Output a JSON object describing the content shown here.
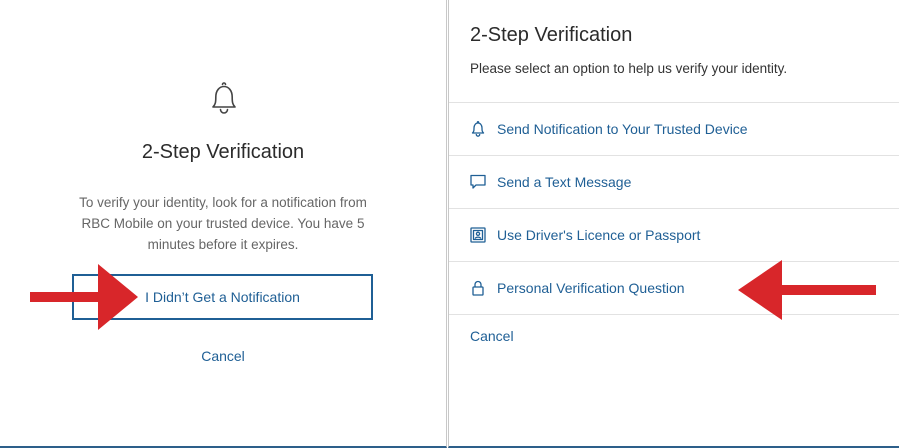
{
  "colors": {
    "link_blue": "#1f5f95",
    "arrow_red": "#d8262a",
    "divider": "#e2e2e2"
  },
  "left_panel": {
    "icon": "bell-icon",
    "title": "2-Step Verification",
    "body": "To verify your identity, look for a notification from RBC Mobile on your trusted device. You have 5 minutes before it expires.",
    "button_label": "I Didn’t Get a Notification",
    "cancel_label": "Cancel"
  },
  "right_panel": {
    "title": "2-Step Verification",
    "subtitle": "Please select an option to help us verify your identity.",
    "options": [
      {
        "label": "Send Notification to Your Trusted Device",
        "icon": "bell-icon"
      },
      {
        "label": "Send a Text Message",
        "icon": "chat-bubble-icon"
      },
      {
        "label": "Use Driver's Licence or Passport",
        "icon": "id-card-icon"
      },
      {
        "label": "Personal Verification Question",
        "icon": "lock-icon"
      }
    ],
    "cancel_label": "Cancel"
  }
}
